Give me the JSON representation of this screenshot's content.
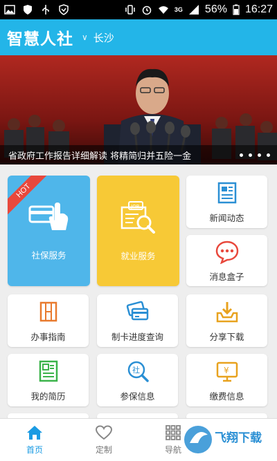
{
  "status_bar": {
    "battery": "56%",
    "time": "16:27",
    "network": "3G"
  },
  "header": {
    "title": "智慧人社",
    "city": "长沙",
    "color": "#23b5e8"
  },
  "banner": {
    "caption": "省政府工作报告详细解读 将精简归并五险一金",
    "slides_total": 4,
    "slide_active": 1
  },
  "tiles": {
    "hot_badge": "HOT",
    "social_insurance": {
      "label": "社保服务",
      "color": "#4fb6ea",
      "icon": "card-hand-icon"
    },
    "employment": {
      "label": "就业服务",
      "color": "#f7c936",
      "icon": "job-search-icon"
    },
    "news": {
      "label": "新闻动态",
      "icon": "newspaper-icon"
    },
    "messages": {
      "label": "消息盒子",
      "icon": "chat-bubble-icon"
    },
    "guide": {
      "label": "办事指南",
      "icon": "book-icon"
    },
    "card_progress": {
      "label": "制卡进度查询",
      "icon": "cards-icon"
    },
    "share_download": {
      "label": "分享下载",
      "icon": "download-tray-icon"
    },
    "resume": {
      "label": "我的简历",
      "icon": "resume-icon"
    },
    "insurance_info": {
      "label": "参保信息",
      "icon": "magnifier-she-icon"
    },
    "payment_info": {
      "label": "缴费信息",
      "icon": "yuan-screen-icon"
    }
  },
  "bottom_nav": {
    "home": "首页",
    "custom": "定制",
    "navigation": "导航",
    "watermark": "飞翔下载"
  }
}
